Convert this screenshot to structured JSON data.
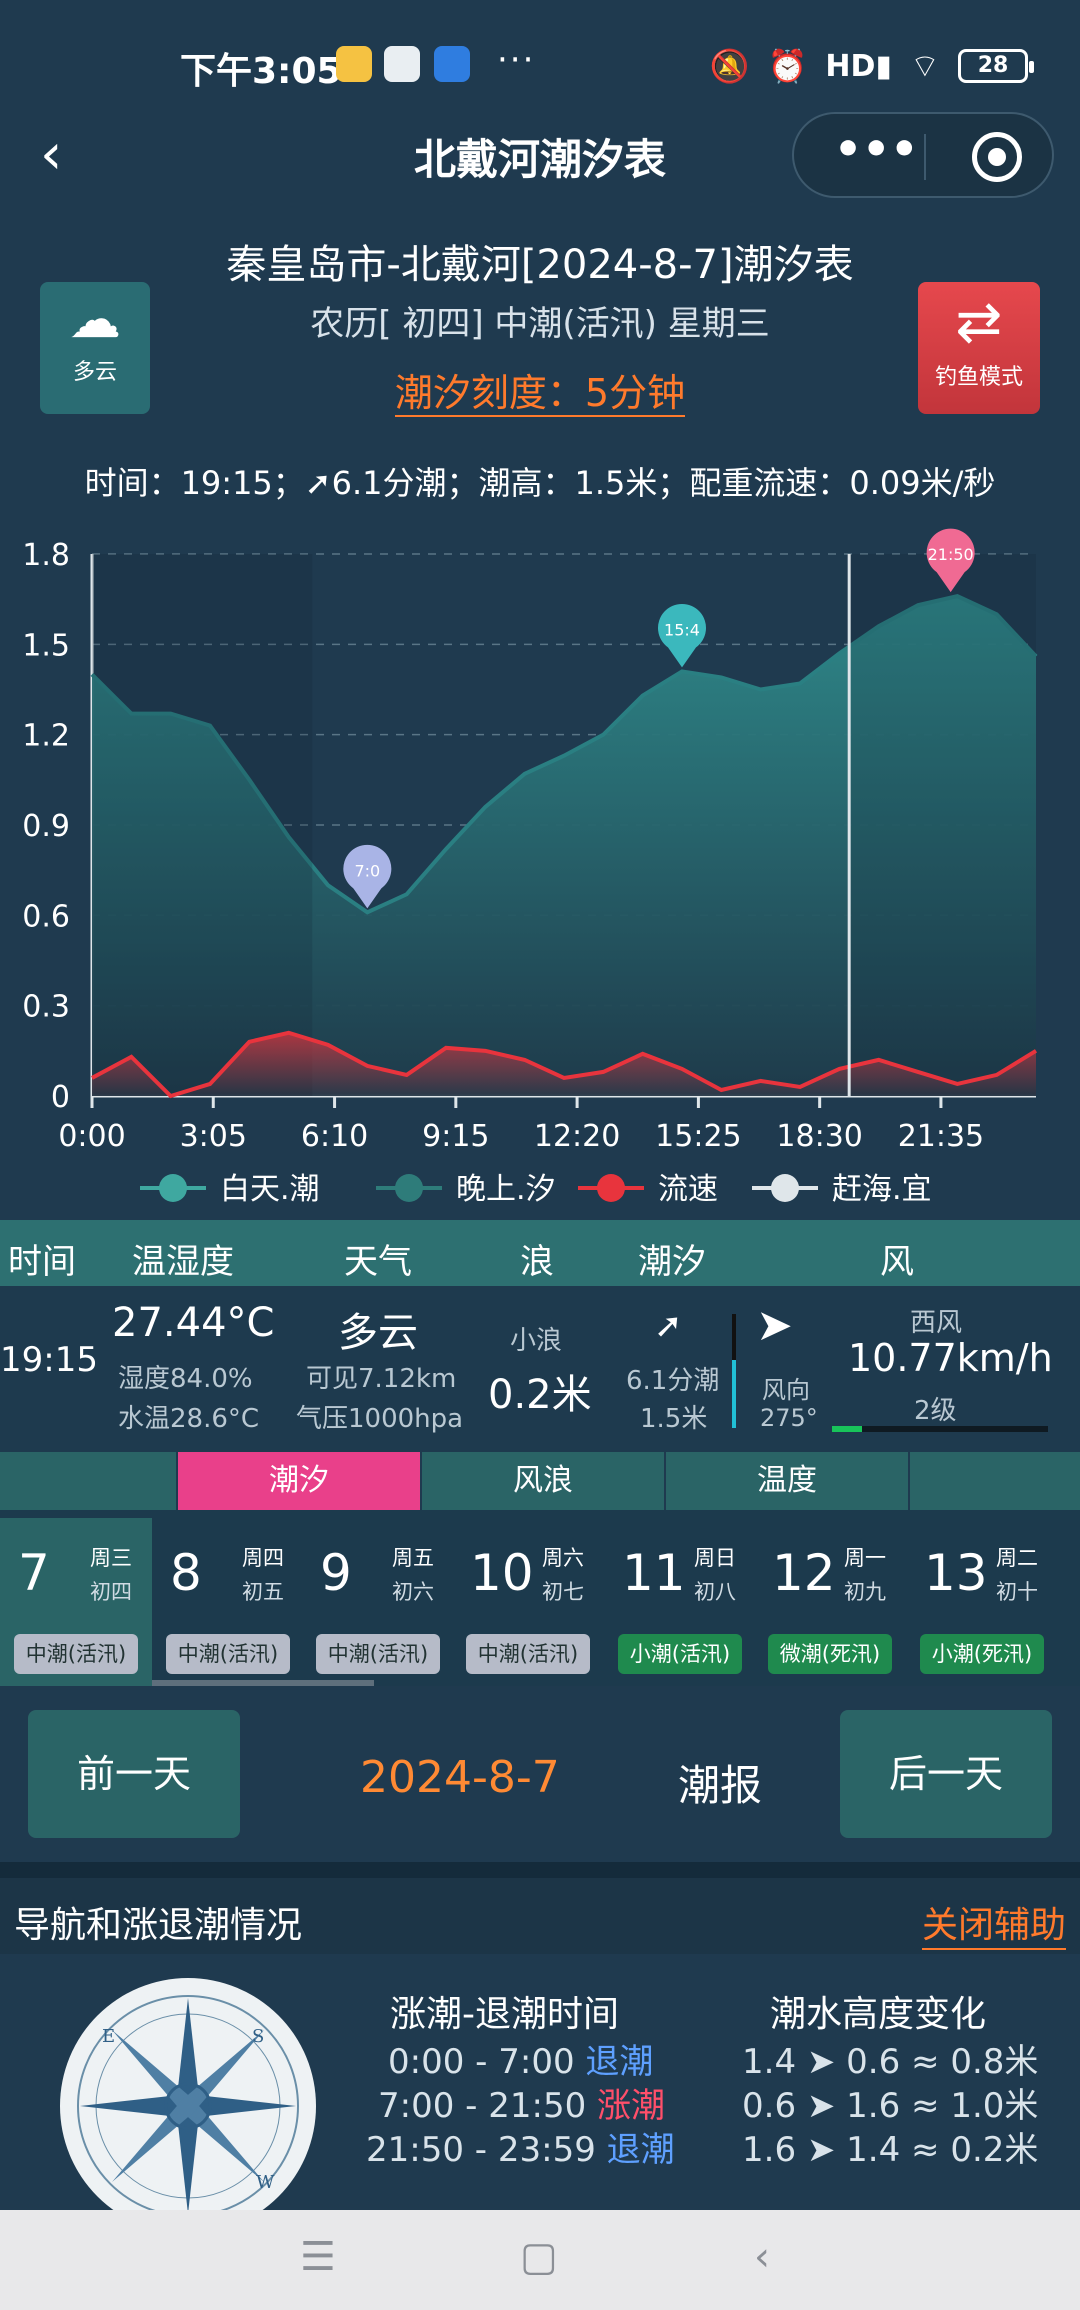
{
  "status_bar": {
    "time": "下午3:05",
    "more": "···",
    "battery": "28"
  },
  "nav": {
    "back_icon": "‹",
    "title": "北戴河潮汐表",
    "capsule_more": "•••"
  },
  "header": {
    "weather_label": "多云",
    "title": "秦皇岛市-北戴河[2024-8-7]潮汐表",
    "lunar": "农历[ 初四] 中潮(活汛) 星期三",
    "scale": "潮汐刻度：5分钟",
    "fishing_label": "钓鱼模式"
  },
  "info_line": "时间：19:15；➚6.1分潮；潮高：1.5米；配重流速：0.09米/秒",
  "chart_data": {
    "type": "area",
    "x_ticks": [
      "0:00",
      "3:05",
      "6:10",
      "9:15",
      "12:20",
      "15:25",
      "18:30",
      "21:35"
    ],
    "y_ticks": [
      "0",
      "0.3",
      "0.6",
      "0.9",
      "1.2",
      "1.5",
      "1.8"
    ],
    "ylim": [
      0,
      1.8
    ],
    "xlim_hours": [
      0,
      24
    ],
    "cursor_time_hours": 19.25,
    "series": [
      {
        "name": "白天.潮",
        "color": "#2f8c8c",
        "x": [
          0,
          1,
          2,
          3,
          4,
          5,
          6,
          7,
          8,
          9,
          10,
          11,
          12,
          13,
          14,
          15,
          16,
          17,
          18,
          19,
          20,
          21,
          22,
          23,
          24
        ],
        "values": [
          1.4,
          1.27,
          1.27,
          1.23,
          1.05,
          0.86,
          0.7,
          0.61,
          0.67,
          0.82,
          0.96,
          1.07,
          1.13,
          1.2,
          1.33,
          1.41,
          1.39,
          1.35,
          1.37,
          1.47,
          1.56,
          1.63,
          1.66,
          1.6,
          1.46
        ]
      },
      {
        "name": "流速",
        "color": "#e8343d",
        "x": [
          0,
          1,
          2,
          3,
          4,
          5,
          6,
          7,
          8,
          9,
          10,
          11,
          12,
          13,
          14,
          15,
          16,
          17,
          18,
          19,
          20,
          21,
          22,
          23,
          24
        ],
        "values": [
          0.06,
          0.13,
          0.0,
          0.04,
          0.18,
          0.21,
          0.17,
          0.1,
          0.07,
          0.16,
          0.15,
          0.12,
          0.06,
          0.08,
          0.14,
          0.09,
          0.02,
          0.05,
          0.03,
          0.09,
          0.12,
          0.08,
          0.04,
          0.07,
          0.15
        ]
      }
    ],
    "markers": [
      {
        "label": "7:0",
        "x": 7,
        "y": 0.61,
        "color": "#a9b4e6"
      },
      {
        "label": "15:4",
        "x": 15,
        "y": 1.41,
        "color": "#3bb8bd"
      },
      {
        "label": "21:50",
        "x": 21.83,
        "y": 1.66,
        "color": "#f06a93"
      }
    ],
    "legend": [
      {
        "label": "白天.潮",
        "color": "#3fa8a0"
      },
      {
        "label": "晚上.汐",
        "color": "#2e7c7a"
      },
      {
        "label": "流速",
        "color": "#e8343d"
      },
      {
        "label": "赶海.宜",
        "color": "#dfe6ea"
      }
    ],
    "legend_position": "bottom"
  },
  "table": {
    "headers": [
      "时间",
      "温湿度",
      "天气",
      "浪",
      "潮汐",
      "风"
    ],
    "time": "19:15",
    "temp": "27.44°C",
    "humidity": "湿度84.0%",
    "water_temp": "水温28.6°C",
    "weather": "多云",
    "visibility": "可见7.12km",
    "pressure": "气压1000hpa",
    "wave_label": "小浪",
    "wave_value": "0.2米",
    "tide_arrow": "➚",
    "tide_minutes": "6.1分潮",
    "tide_height": "1.5米",
    "wind_dir_label": "风向",
    "wind_deg": "275°",
    "wind_name": "西风",
    "wind_speed": "10.77km/h",
    "wind_level": "2级",
    "wind_level_fraction": 0.14
  },
  "tabs": [
    "潮汐",
    "风浪",
    "温度"
  ],
  "days": [
    {
      "num": "7",
      "week": "周三",
      "lunar": "初四",
      "tag": "中潮(活汛)",
      "tag_color": "gray"
    },
    {
      "num": "8",
      "week": "周四",
      "lunar": "初五",
      "tag": "中潮(活汛)",
      "tag_color": "gray"
    },
    {
      "num": "9",
      "week": "周五",
      "lunar": "初六",
      "tag": "中潮(活汛)",
      "tag_color": "gray"
    },
    {
      "num": "10",
      "week": "周六",
      "lunar": "初七",
      "tag": "中潮(活汛)",
      "tag_color": "gray"
    },
    {
      "num": "11",
      "week": "周日",
      "lunar": "初八",
      "tag": "小潮(活汛)",
      "tag_color": "green"
    },
    {
      "num": "12",
      "week": "周一",
      "lunar": "初九",
      "tag": "微潮(死汛)",
      "tag_color": "green"
    },
    {
      "num": "13",
      "week": "周二",
      "lunar": "初十",
      "tag": "小潮(死汛)",
      "tag_color": "green"
    }
  ],
  "navigation": {
    "prev": "前一天",
    "date": "2024-8-7",
    "report": "潮报",
    "next": "后一天"
  },
  "section": {
    "title": "导航和涨退潮情况",
    "link": "关闭辅助",
    "ebb_title": "涨潮-退潮时间",
    "ebb": [
      {
        "range": "0:00 - 7:00",
        "state": "退潮",
        "color": "blue"
      },
      {
        "range": "7:00 - 21:50",
        "state": "涨潮",
        "color": "red"
      },
      {
        "range": "21:50 - 23:59",
        "state": "退潮",
        "color": "blue"
      }
    ],
    "height_title": "潮水高度变化",
    "heights": [
      "1.4 ➤ 0.6 ≈ 0.8米",
      "0.6 ➤ 1.6 ≈ 1.0米",
      "1.6 ➤ 1.4 ≈ 0.2米"
    ]
  }
}
